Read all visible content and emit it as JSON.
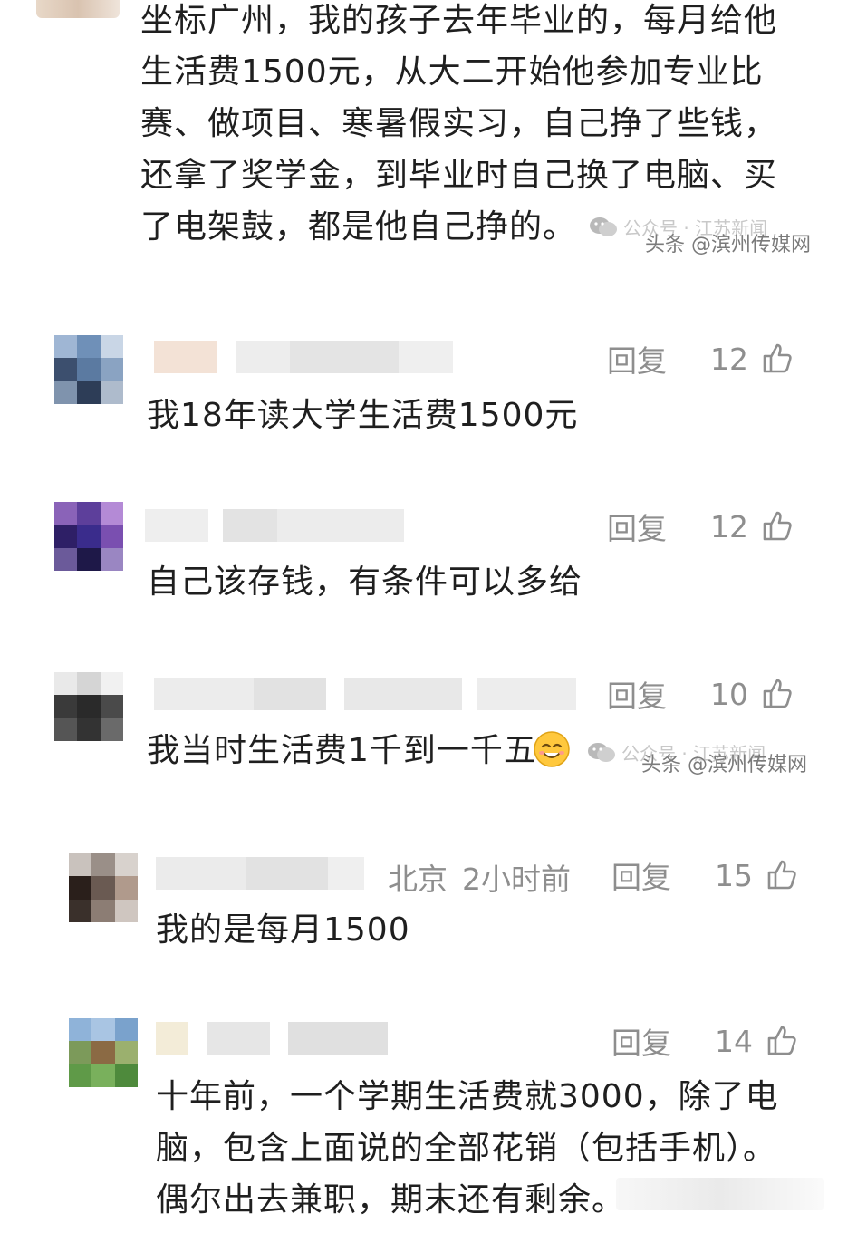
{
  "top_comment": {
    "lines": [
      "坐标广州，我的孩子去年毕业的，每月给他",
      "生活费1500元，从大二开始他参加专业比",
      "赛、做项目、寒暑假实习，自己挣了些钱，",
      "还拿了奖学金，到毕业时自己换了电脑、买",
      "了电架鼓，都是他自己挣的。"
    ]
  },
  "watermark": {
    "wechat_text": "公众号 · 江苏新闻",
    "source_text": "头条 @滨州传媒网"
  },
  "reply_label": "回复",
  "comments": [
    {
      "text": "我18年读大学生活费1500元",
      "likes": "12"
    },
    {
      "text": "自己该存钱，有条件可以多给",
      "likes": "12"
    },
    {
      "text": "我当时生活费1千到一千五",
      "likes": "10"
    },
    {
      "text": "我的是每月1500",
      "likes": "15",
      "location": "北京",
      "time": "2小时前"
    },
    {
      "text_lines": [
        "十年前，一个学期生活费就3000，除了电",
        "脑，包含上面说的全部花销（包括手机）。",
        "偶尔出去兼职，期末还有剩余。"
      ],
      "likes": "14"
    }
  ],
  "colors": {
    "text": "#1f1f1f",
    "meta": "#8e8e8e"
  },
  "icons": {
    "like": "thumbs-up-icon",
    "wechat": "wechat-icon",
    "emoji": "smile-emoji-icon"
  }
}
